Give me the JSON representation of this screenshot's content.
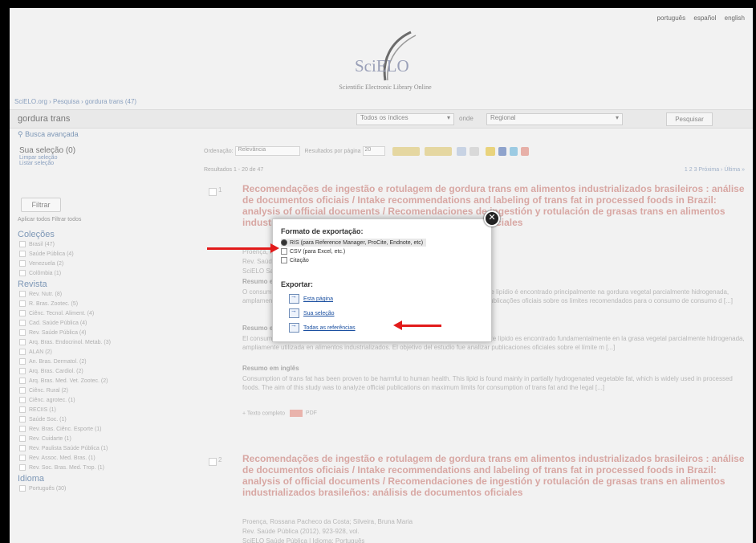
{
  "topnav": [
    "português",
    "español",
    "english"
  ],
  "logo": {
    "text": "SciELO",
    "tagline": "Scientific Electronic Library Online"
  },
  "breadcrumb": "SciELO.org › Pesquisa › gordura trans (47)",
  "search": {
    "query": "gordura trans",
    "index_select": "Todos os índices",
    "with_label": "onde",
    "region_select": "Regional",
    "button": "Pesquisar",
    "advanced": "Busca avançada"
  },
  "sidebar": {
    "selection_title": "Sua seleção (0)",
    "selection_links": [
      "Limpar seleção",
      "Listar seleção"
    ],
    "filter_button": "Filtrar",
    "filter_options": "Aplicar todos  Filtrar todos",
    "facets": [
      {
        "title": "Coleções",
        "items": [
          "Brasil (47)",
          "Saúde Pública (4)",
          "Venezuela (2)",
          "Colômbia (1)"
        ]
      },
      {
        "title": "Revista",
        "items": [
          "Rev. Nutr. (8)",
          "R. Bras. Zootec. (5)",
          "Ciênc. Tecnol. Aliment. (4)",
          "Cad. Saúde Pública (4)",
          "Rev. Saúde Pública (4)",
          "Arq. Bras. Endocrinol. Metab. (3)",
          "ALAN (2)",
          "An. Bras. Dermatol. (2)",
          "Arq. Bras. Cardiol. (2)",
          "Arq. Bras. Med. Vet. Zootec. (2)",
          "Ciênc. Rural (2)",
          "Ciênc. agrotec. (1)",
          "RECIIS (1)",
          "Saúde Soc. (1)",
          "Rev. Bras. Ciênc. Esporte (1)",
          "Rev. Cuidarte (1)",
          "Rev. Paulista Saúde Pública (1)",
          "Rev. Assoc. Med. Bras. (1)",
          "Rev. Soc. Bras. Med. Trop. (1)"
        ]
      },
      {
        "title": "Idioma",
        "items": [
          "Português (30)"
        ]
      }
    ]
  },
  "toolbar": {
    "order_label": "Ordenação:",
    "order_value": "Relevância",
    "per_page_label": "Resultados por página",
    "per_page_value": "20",
    "results_count": "Resultados 1 - 20 de 47",
    "pager": "1 2 3 Próxima › Última »"
  },
  "results": [
    {
      "num": "1",
      "title": "Recomendações de ingestão e rotulagem de gordura trans em alimentos industrializados brasileiros : análise de documentos oficiais / Intake recommendations and labeling of trans fat in processed foods in Brazil: analysis of official documents / Recomendaciones de ingestión y rotulación de grasas trans en alimentos industrializados brasileños: análisis de documentos oficiales",
      "authors": "Proença, Rossana Pacheco da Costa; Silveira, Bruna Maria",
      "source": "Rev. Saúde Pública (2012), 923-928, vol.",
      "collection": "SciELO Saúde Pública | Idioma: Português",
      "summary_head": "Resumo em português",
      "summary_text": "O consumo de gordura trans tem sido apontado como prejudicial à saúde humana. Esse lipídio é encontrado principalmente na gordura vegetal parcialmente hidrogenada, amplamente utilizada em alimentos industrializados. O objetivo do estudo foi analisar publicações oficiais sobre os limites recomendados para o consumo de consumo d [...]",
      "summary2_head": "Resumo em espanhol",
      "summary2_text": "El consumo de grasas trans se ha apuntado como perjudicial para la salud humana. Este lípido es encontrado fundamentalmente en la grasa vegetal parcialmente hidrogenada, ampliamente utilizada en alimentos industrializados. El objetivo del estudio fue analizar publicaciones oficiales sobre el límite m [...]",
      "summary3_head": "Resumo em inglês",
      "summary3_text": "Consumption of trans fat has been proven to be harmful to human health. This lipid is found mainly in partially hydrogenated vegetable fat, which is widely used in processed foods. The aim of this study was to analyze official publications on maximum limits for consumption of trans fat and the legal [...]",
      "fulltext": "+ Texto completo",
      "pdf": "PDF"
    },
    {
      "num": "2",
      "title": "Recomendações de ingestão e rotulagem de gordura trans em alimentos industrializados brasileiros : análise de documentos oficiais / Intake recommendations and labeling of trans fat in processed foods in Brazil: analysis of official documents / Recomendaciones de ingestión y rotulación de grasas trans en alimentos industrializados brasileños: análisis de documentos oficiales",
      "authors": "Proença, Rossana Pacheco da Costa; Silveira, Bruna Maria",
      "source": "Rev. Saúde Pública (2012), 923-928, vol.",
      "collection": "SciELO Saúde Pública | Idioma: Português"
    }
  ],
  "modal": {
    "format_title": "Formato de exportação:",
    "format_options": [
      "RIS (para Reference Manager, ProCite, Endnote, etc)",
      "CSV (para Excel, etc.)",
      "Citação"
    ],
    "export_title": "Exportar:",
    "export_options": [
      "Esta página",
      "Sua seleção",
      "Todas as referências"
    ]
  }
}
